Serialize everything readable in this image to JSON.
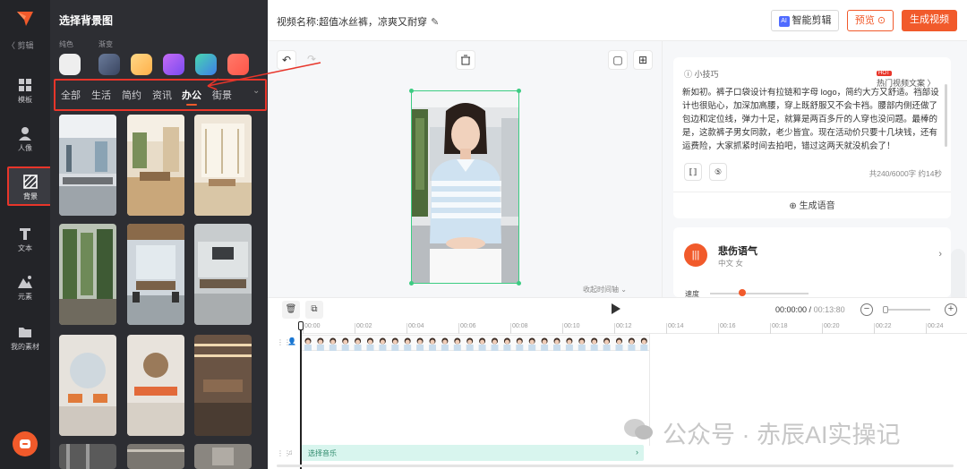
{
  "rail": {
    "back_label": "〈 剪辑",
    "items": [
      {
        "label": "模板",
        "icon": "template-icon"
      },
      {
        "label": "人像",
        "icon": "portrait-icon"
      },
      {
        "label": "背景",
        "icon": "background-icon",
        "active": true
      },
      {
        "label": "文本",
        "icon": "text-icon"
      },
      {
        "label": "元素",
        "icon": "element-icon"
      },
      {
        "label": "我的素材",
        "icon": "folder-icon"
      }
    ]
  },
  "bg_panel": {
    "title": "选择背景图",
    "solid_label": "纯色",
    "gradient_label": "渐变",
    "solid_color": "#eeeeee",
    "gradients": [
      "#5a6b8a",
      "#ffc76a",
      "#a26bf5",
      "#3fb8c8",
      "#ff6a5a"
    ],
    "tabs": [
      {
        "label": "全部"
      },
      {
        "label": "生活"
      },
      {
        "label": "简约"
      },
      {
        "label": "资讯"
      },
      {
        "label": "办公",
        "active": true
      },
      {
        "label": "街景"
      }
    ],
    "more_icon": "chevron-down-icon"
  },
  "header": {
    "video_name_label": "视频名称:",
    "video_name": "超值冰丝裤，凉爽又耐穿",
    "ai_edit": "智能剪辑",
    "ai_badge": "AI",
    "preview": "预览",
    "generate": "生成视频"
  },
  "canvas": {
    "collapse_timeline": "收起时间轴"
  },
  "script_card": {
    "tip_label": "小技巧",
    "hot_badge": "HOT",
    "hot_label": "热门视频文案 〉",
    "text": "新如初。裤子口袋设计有拉链和字母 logo，简约大方又舒适。裆部设计也很贴心，加深加高腰，穿上既舒服又不会卡裆。腰部内侧还做了包边和定位线，弹力十足，就算是两百多斤的人穿也没问题。最棒的是，这款裤子男女同款，老少皆宜。现在活动价只要十几块钱，还有运费险，大家抓紧时间去拍吧，错过这两天就没机会了！",
    "count": "共240/6000字 约14秒",
    "generate_voice": "生成语音"
  },
  "voice_card": {
    "name": "悲伤语气",
    "sub": "中文  女",
    "speed_label": "速度",
    "speed": 0.3
  },
  "timeline": {
    "current_time": "00:00:00",
    "total_time": "00:13:80",
    "ticks": [
      "00:00",
      "00:02",
      "00:04",
      "00:06",
      "00:08",
      "00:10",
      "00:12",
      "00:14",
      "00:16",
      "00:18",
      "00:20",
      "00:22",
      "00:24"
    ],
    "music_label": "选择音乐"
  },
  "watermark": "公众号 · 赤辰AI实操记"
}
